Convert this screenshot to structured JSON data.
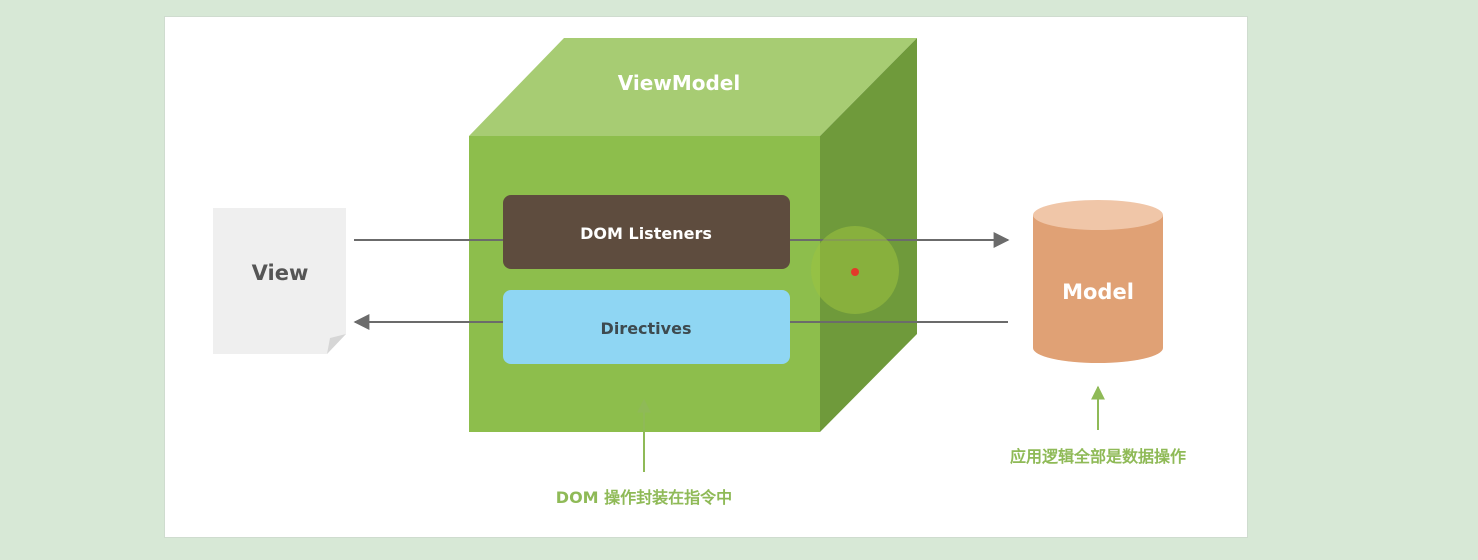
{
  "diagram": {
    "viewmodel_label": "ViewModel",
    "dom_listeners_label": "DOM Listeners",
    "directives_label": "Directives",
    "view_label": "View",
    "model_label": "Model",
    "caption_dom": "DOM 操作封装在指令中",
    "caption_model": "应用逻辑全部是数据操作"
  },
  "colors": {
    "cube_front": "#8dbe4c",
    "cube_top": "#a7cc73",
    "cube_side": "#6f9a3b",
    "dom_listeners": "#5e4c3e",
    "directives": "#8fd6f3",
    "model": "#e0a175",
    "caption": "#8fba57",
    "arrow": "#6b6b6b"
  }
}
